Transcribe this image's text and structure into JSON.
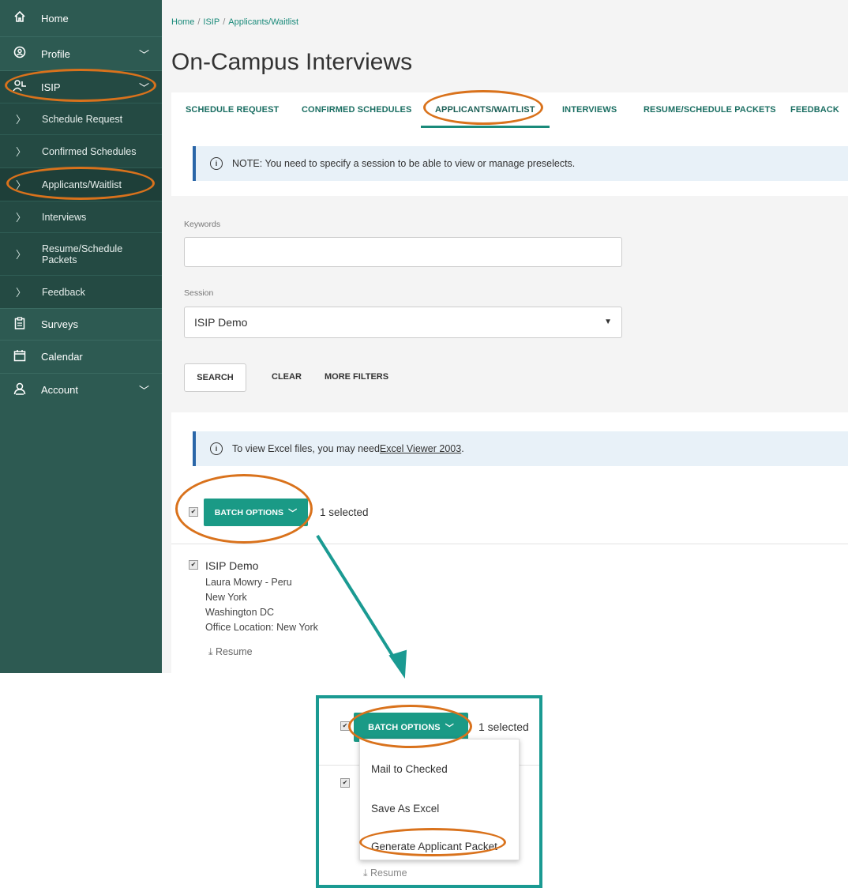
{
  "sidebar": {
    "items": [
      {
        "label": "Home",
        "icon": "home-icon"
      },
      {
        "label": "Profile",
        "icon": "profile-icon",
        "chevron": "﹀"
      },
      {
        "label": "ISIP",
        "icon": "isip-icon",
        "chevron": "﹀"
      },
      {
        "label": "Surveys",
        "icon": "clipboard-icon"
      },
      {
        "label": "Calendar",
        "icon": "calendar-icon"
      },
      {
        "label": "Account",
        "icon": "account-icon",
        "chevron": "﹀"
      }
    ],
    "sub_items": [
      {
        "label": "Schedule Request"
      },
      {
        "label": "Confirmed Schedules"
      },
      {
        "label": "Applicants/Waitlist"
      },
      {
        "label": "Interviews"
      },
      {
        "label": "Resume/Schedule Packets"
      },
      {
        "label": "Feedback"
      }
    ]
  },
  "breadcrumb": {
    "home": "Home",
    "isip": "ISIP",
    "current": "Applicants/Waitlist",
    "separator": "/"
  },
  "page_title": "On-Campus Interviews",
  "tabs": [
    {
      "label": "SCHEDULE REQUEST"
    },
    {
      "label": "CONFIRMED SCHEDULES"
    },
    {
      "label": "APPLICANTS/WAITLIST"
    },
    {
      "label": "INTERVIEWS"
    },
    {
      "label": "RESUME/SCHEDULE PACKETS"
    },
    {
      "label": "FEEDBACK"
    }
  ],
  "note": {
    "text": "NOTE: You need to specify a session to be able to view or manage preselects."
  },
  "filters": {
    "keywords_label": "Keywords",
    "keywords_value": "",
    "session_label": "Session",
    "session_value": "ISIP Demo",
    "search_label": "SEARCH",
    "clear_label": "CLEAR",
    "more_filters_label": "MORE FILTERS"
  },
  "excel_note": {
    "prefix": "To view Excel files, you may need ",
    "link": "Excel Viewer 2003",
    "suffix": "."
  },
  "batch": {
    "label": "BATCH OPTIONS",
    "chevron": "﹀",
    "selected_text": "1 selected"
  },
  "applicant": {
    "title": "ISIP Demo",
    "lines": [
      "Laura Mowry - Peru",
      "New York",
      "Washington DC",
      "Office Location: New York"
    ],
    "resume_label": "Resume",
    "resume_icon": "download-icon"
  },
  "dropdown": {
    "items": [
      {
        "label": "Mail to Checked"
      },
      {
        "label": "Save As Excel"
      },
      {
        "label": "Generate Applicant Packet"
      }
    ]
  },
  "colors": {
    "sidebar": "#2d5a52",
    "accent": "#1a9a86",
    "highlight": "#d9721c",
    "arrow": "#1a9a92"
  }
}
